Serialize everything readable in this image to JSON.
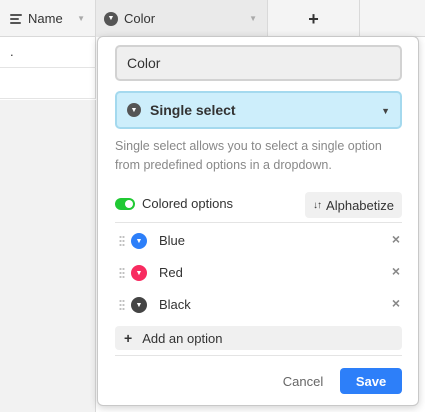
{
  "grid": {
    "columns": [
      {
        "label": "Name",
        "icon": "text-lines-icon"
      },
      {
        "label": "Color",
        "icon": "single-select-icon"
      }
    ],
    "add_column_label": "+",
    "rows": [
      {
        "name": "."
      },
      {
        "name": ""
      }
    ]
  },
  "panel": {
    "field_name_value": "Color",
    "field_type": "Single select",
    "description": "Single select allows you to select a single option from predefined options in a dropdown.",
    "colored_options_label": "Colored options",
    "colored_options_on": true,
    "alphabetize_label": "Alphabetize",
    "options": [
      {
        "name": "Blue",
        "color": "#2d7ff9"
      },
      {
        "name": "Red",
        "color": "#f82b60"
      },
      {
        "name": "Black",
        "color": "#444444"
      }
    ],
    "add_option_label": "Add an option",
    "cancel_label": "Cancel",
    "save_label": "Save"
  },
  "colors": {
    "accent": "#2d7ff9",
    "type_select_bg": "#cdeefb",
    "toggle_on": "#20c933"
  }
}
